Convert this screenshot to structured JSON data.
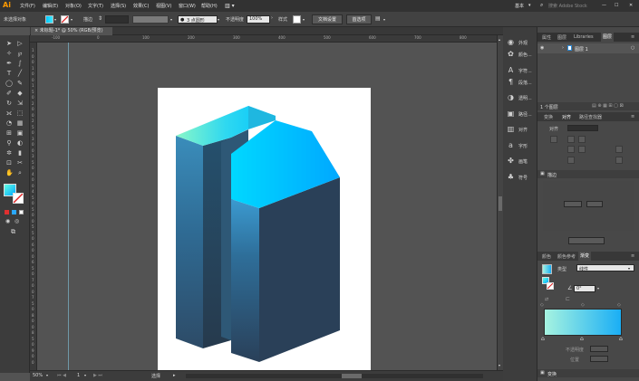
{
  "app": {
    "logo": "Ai"
  },
  "menu": [
    "文件(F)",
    "编辑(E)",
    "对象(O)",
    "文字(T)",
    "选择(S)",
    "效果(C)",
    "视图(V)",
    "窗口(W)",
    "帮助(H)"
  ],
  "workspace": {
    "label": "基本",
    "search_placeholder": "搜索 Adobe Stock"
  },
  "control": {
    "selection_status": "未选择对象",
    "stroke_label": "描边",
    "brush_value": "3 点圆形",
    "opacity_label": "不透明度",
    "opacity_value": "100%",
    "style_label": "样式",
    "doc_setup": "文档设置",
    "preferences": "首选项"
  },
  "document": {
    "tab_title": "未标题-1* @ 50% (RGB/预览)",
    "zoom": "50%",
    "artboard_index": "1",
    "status_tool": "选择"
  },
  "ruler_h": [
    "-100",
    "0",
    "100",
    "200",
    "300",
    "400",
    "500",
    "600",
    "700",
    "800",
    "900",
    "1000"
  ],
  "ruler_v": [
    "1",
    "0",
    "0",
    "1",
    "0",
    "0",
    "1",
    "5",
    "0",
    "2",
    "0",
    "0",
    "2",
    "5",
    "0",
    "3",
    "0",
    "0",
    "3",
    "5",
    "0",
    "4",
    "0",
    "0",
    "4",
    "5",
    "0",
    "5",
    "0",
    "0",
    "5",
    "5",
    "0",
    "6",
    "0",
    "0",
    "6",
    "5",
    "0",
    "7",
    "0",
    "0",
    "7",
    "5",
    "0",
    "8",
    "0",
    "0",
    "8",
    "5",
    "0",
    "9",
    "0",
    "0"
  ],
  "icon_panel": [
    {
      "icon": "appearance-icon",
      "label": "外观"
    },
    {
      "icon": "swatch-icon",
      "label": "颜色..."
    },
    {
      "icon": "char-icon",
      "label": "字符..."
    },
    {
      "icon": "paragraph-icon",
      "label": "段落..."
    },
    {
      "icon": "transparency-icon",
      "label": "透明..."
    },
    {
      "icon": "pathfinder-icon",
      "label": "路径..."
    },
    {
      "icon": "align-icon",
      "label": "对齐"
    },
    {
      "icon": "glyph-icon",
      "label": "字形"
    },
    {
      "icon": "brush-icon",
      "label": "画笔"
    },
    {
      "icon": "symbol-icon",
      "label": "符号"
    }
  ],
  "layers_panel": {
    "tabs": [
      "属性",
      "图层",
      "Libraries",
      "图层"
    ],
    "active_tab": 3,
    "layer_name": "图层 1",
    "footer": "1 个图层"
  },
  "align_panel": {
    "tabs": [
      "变换",
      "对齐",
      "路径查找器"
    ],
    "active_tab": 1,
    "row_label": "对齐"
  },
  "stroke_panel": {
    "title": "描边"
  },
  "gradient_panel": {
    "tabs": [
      "颜色",
      "颜色参考",
      "渐变"
    ],
    "active_tab": 2,
    "type_label": "类型",
    "type_value": "线性",
    "angle_value": "0°",
    "opacity_label": "不透明度",
    "position_label": "位置",
    "gradient_start": "#a6f3e0",
    "gradient_end": "#1aaef5"
  },
  "bottom_panel": {
    "title": "变换"
  },
  "colors": {
    "face_dark": "#2b4660",
    "face_top_start": "#00e0ff",
    "face_top_end": "#70ffd0",
    "accent": "#1473e6"
  }
}
